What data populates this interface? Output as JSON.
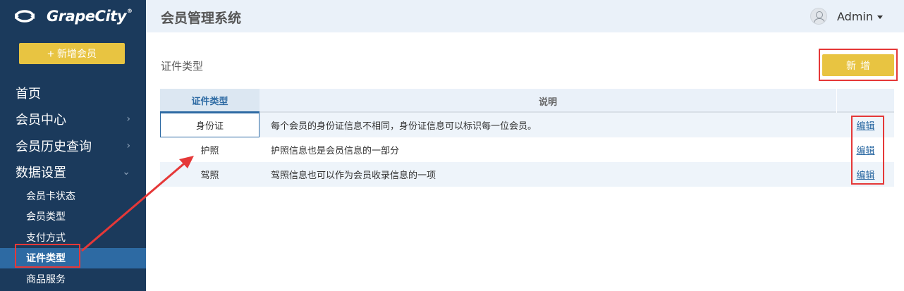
{
  "brand": {
    "logo_text": "GrapeCity",
    "registered": "®"
  },
  "sidebar": {
    "add_button": {
      "icon": "+",
      "label": "新增会员"
    },
    "nav": [
      {
        "label": "首页",
        "chevron": ""
      },
      {
        "label": "会员中心",
        "chevron": "›"
      },
      {
        "label": "会员历史查询",
        "chevron": "›"
      },
      {
        "label": "数据设置",
        "chevron": "⌄"
      }
    ],
    "subnav": [
      {
        "label": "会员卡状态"
      },
      {
        "label": "会员类型"
      },
      {
        "label": "支付方式"
      },
      {
        "label": "证件类型",
        "active": true
      },
      {
        "label": "商品服务"
      }
    ]
  },
  "header": {
    "title": "会员管理系统",
    "user": "Admin"
  },
  "main": {
    "section_title": "证件类型",
    "new_button": "新增",
    "table": {
      "headers": [
        "证件类型",
        "说明",
        ""
      ],
      "rows": [
        {
          "type": "身份证",
          "desc": "每个会员的身份证信息不相同，身份证信息可以标识每一位会员。",
          "action": "编辑"
        },
        {
          "type": "护照",
          "desc": "护照信息也是会员信息的一部分",
          "action": "编辑"
        },
        {
          "type": "驾照",
          "desc": "驾照信息也可以作为会员收录信息的一项",
          "action": "编辑"
        }
      ]
    }
  },
  "colors": {
    "sidebar": "#1b3a5c",
    "accent": "#e8c441",
    "active": "#2d6aa3",
    "highlight": "#e53838"
  }
}
